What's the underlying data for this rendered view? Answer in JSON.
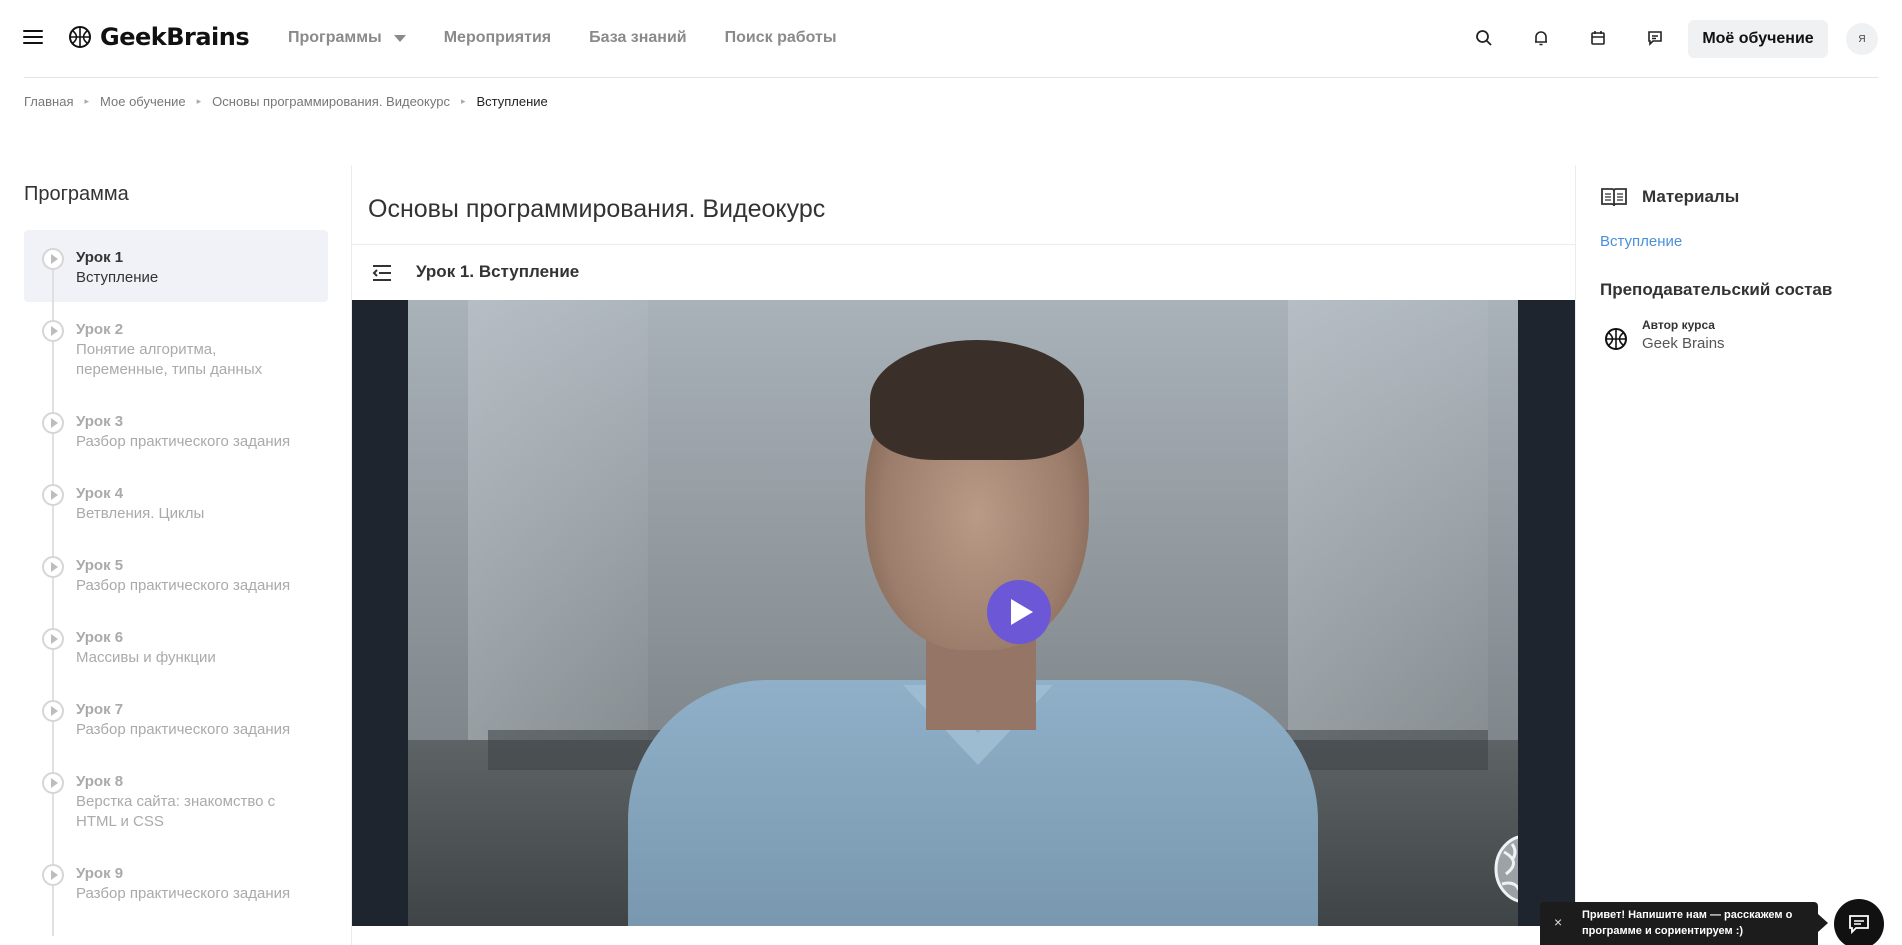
{
  "header": {
    "logo_text": "GeekBrains",
    "nav": [
      {
        "label": "Программы",
        "has_dropdown": true
      },
      {
        "label": "Мероприятия"
      },
      {
        "label": "База знаний"
      },
      {
        "label": "Поиск работы"
      }
    ],
    "icons": [
      "search-icon",
      "bell-icon",
      "calendar-icon",
      "chat-icon"
    ],
    "my_learning_label": "Моё обучение",
    "avatar_text": "Я"
  },
  "breadcrumb": [
    "Главная",
    "Мое обучение",
    "Основы программирования. Видеокурс",
    "Вступление"
  ],
  "program": {
    "title": "Программа",
    "lessons": [
      {
        "num": "Урок 1",
        "name": "Вступление",
        "active": true
      },
      {
        "num": "Урок 2",
        "name": "Понятие алгоритма, переменные, типы данных"
      },
      {
        "num": "Урок 3",
        "name": "Разбор практического задания"
      },
      {
        "num": "Урок 4",
        "name": "Ветвления. Циклы"
      },
      {
        "num": "Урок 5",
        "name": "Разбор практического задания"
      },
      {
        "num": "Урок 6",
        "name": "Массивы и функции"
      },
      {
        "num": "Урок 7",
        "name": "Разбор практического задания"
      },
      {
        "num": "Урок 8",
        "name": "Верстка сайта: знакомство с HTML и CSS"
      },
      {
        "num": "Урок 9",
        "name": "Разбор практического задания"
      }
    ]
  },
  "main": {
    "course_title": "Основы программирования. Видеокурс",
    "lesson_title": "Урок 1. Вступление"
  },
  "materials": {
    "title": "Материалы",
    "link": "Вступление",
    "teachers_title": "Преподавательский состав",
    "teacher_role": "Автор курса",
    "teacher_name": "Geek Brains"
  },
  "chat": {
    "tip": "Привет! Напишите нам — расскажем о программе и сориентируем :)",
    "close": "×"
  },
  "colors": {
    "accent_play": "#6c57d6",
    "link": "#4a90d9",
    "active_bg": "#f0f2f7",
    "video_bg": "#1f252e"
  }
}
